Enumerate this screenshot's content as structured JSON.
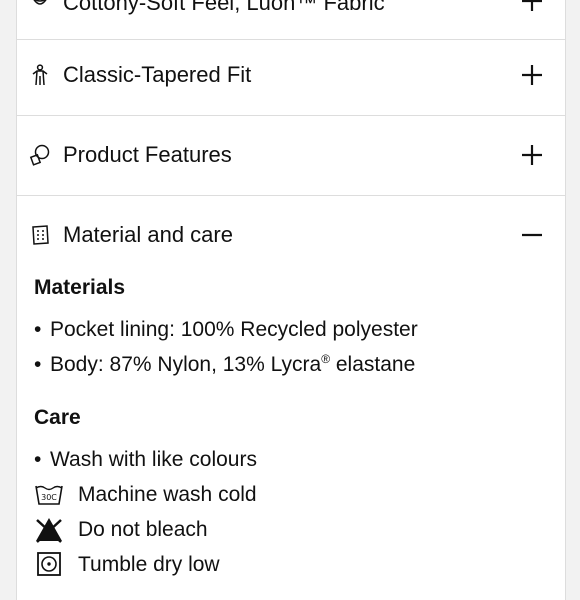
{
  "accordion": {
    "items": [
      {
        "label": "Cottony-Soft Feel, Luon™ Fabric",
        "icon": "fabric-icon",
        "state": "collapsed"
      },
      {
        "label": "Classic-Tapered Fit",
        "icon": "figure-fit-icon",
        "state": "collapsed"
      },
      {
        "label": "Product Features",
        "icon": "features-icon",
        "state": "collapsed"
      },
      {
        "label": "Material and care",
        "icon": "material-tag-icon",
        "state": "expanded"
      }
    ]
  },
  "material_care": {
    "materials_title": "Materials",
    "materials": [
      {
        "text": "Pocket lining: 100% Recycled polyester"
      },
      {
        "text": "Body: 87% Nylon, 13% Lycra",
        "sup": "®",
        "suffix": " elastane"
      }
    ],
    "care_title": "Care",
    "care": [
      {
        "text": "Wash with like colours",
        "icon": "bullet"
      },
      {
        "text": "Machine wash cold",
        "icon": "wash-30c-icon",
        "icon_label": "30C"
      },
      {
        "text": "Do not bleach",
        "icon": "do-not-bleach-icon"
      },
      {
        "text": "Tumble dry low",
        "icon": "tumble-dry-low-icon"
      }
    ]
  },
  "bullet_char": "•",
  "colors": {
    "background": "#f2f2f2",
    "panel": "#ffffff",
    "divider": "#dddddd",
    "text": "#111111"
  }
}
